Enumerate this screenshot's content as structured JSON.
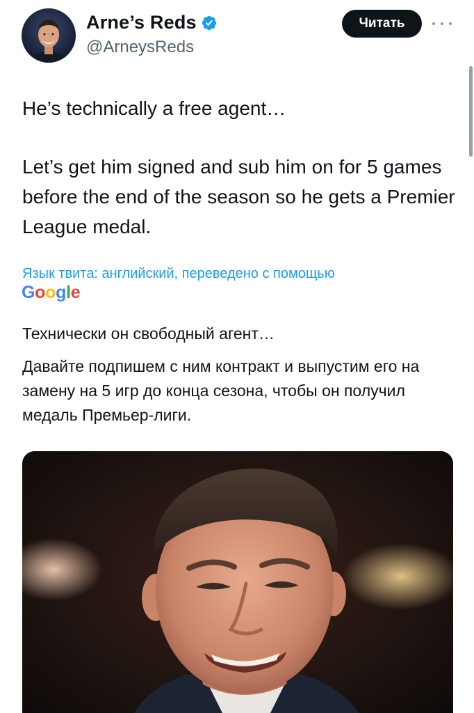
{
  "author": {
    "display_name": "Arne’s Reds",
    "handle": "@ArneysReds",
    "verified": true,
    "verified_icon": "verified-badge-icon",
    "verified_color": "#1d9bf0"
  },
  "follow_button": {
    "label": "Читать"
  },
  "more_icon": "more-horizontal-icon",
  "tweet": {
    "paragraphs": [
      "He’s technically a free agent…",
      "Let’s get him signed and sub him on for 5 games before the end of the season so he gets a Premier League medal."
    ]
  },
  "translation": {
    "note": "Язык твита: английский, переведено с помощью",
    "provider_logo": "Google",
    "paragraphs": [
      "Технически он свободный агент…",
      "Давайте подпишем с ним контракт и выпустим его на замену на 5 игр до конца сезона, чтобы он получил медаль Премьер-лиги."
    ]
  },
  "colors": {
    "text": "#0f1419",
    "secondary_text": "#536471",
    "link_blue": "#1d9bf0",
    "button_bg": "#0f1419",
    "button_text": "#ffffff"
  }
}
